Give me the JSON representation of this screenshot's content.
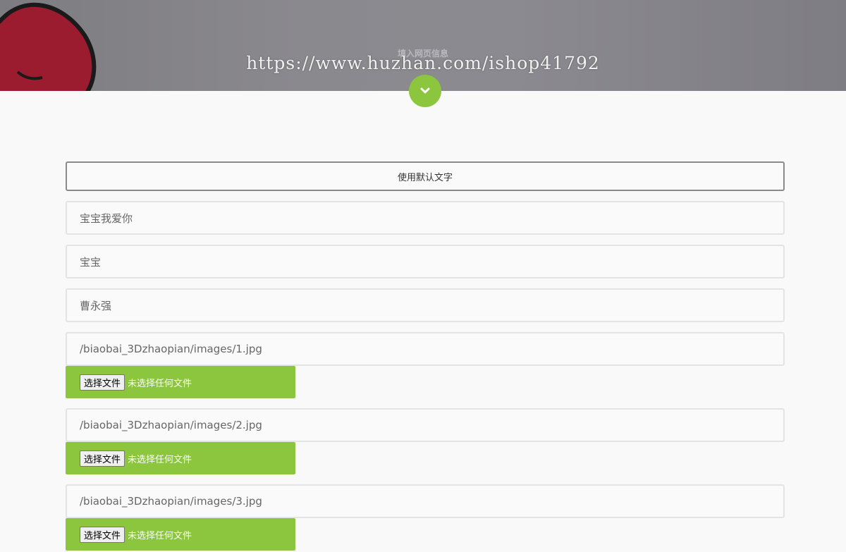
{
  "header": {
    "title": "填入网页信息",
    "watermark": "https://www.huzhan.com/ishop41792",
    "scroll_icon": "chevron-down-icon",
    "accent_color": "#8cc63f"
  },
  "form": {
    "default_text_button": "使用默认文字",
    "text_fields": [
      {
        "value": "宝宝我爱你"
      },
      {
        "value": "宝宝"
      },
      {
        "value": "曹永强"
      }
    ],
    "images": [
      {
        "path": "/biaobai_3Dzhaopian/images/1.jpg",
        "choose_label": "选择文件",
        "status": "未选择任何文件"
      },
      {
        "path": "/biaobai_3Dzhaopian/images/2.jpg",
        "choose_label": "选择文件",
        "status": "未选择任何文件"
      },
      {
        "path": "/biaobai_3Dzhaopian/images/3.jpg",
        "choose_label": "选择文件",
        "status": "未选择任何文件"
      }
    ]
  }
}
